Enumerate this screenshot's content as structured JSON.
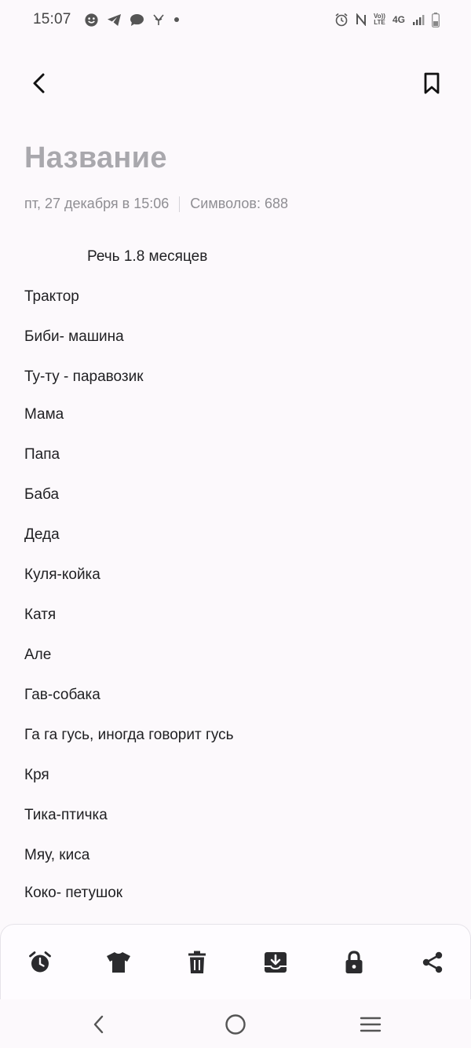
{
  "status_bar": {
    "time": "15:07",
    "left_icons": [
      "smiley-icon",
      "telegram-icon",
      "chat-bubble-icon",
      "vpn-icon",
      "dot-icon"
    ],
    "right_icons": [
      "alarm-icon",
      "nfc-icon",
      "volte-icon",
      "network-4g-icon",
      "signal-icon",
      "battery-icon"
    ],
    "volte_top": "Vo))",
    "volte_bottom": "LTE",
    "network": "4G"
  },
  "top_bar": {
    "back_icon": "chevron-left-icon",
    "bookmark_icon": "bookmark-icon"
  },
  "note": {
    "title": "Название",
    "date": "пт, 27 декабря в 15:06",
    "char_count": "Символов: 688",
    "lines": [
      {
        "text": "Речь 1.8 месяцев",
        "indent": true
      },
      {
        "text": "Трактор"
      },
      {
        "text": "Биби- машина"
      },
      {
        "text": "Ту-ту - паравозик"
      },
      {
        "text": "Мама"
      },
      {
        "text": "Папа"
      },
      {
        "text": "Баба"
      },
      {
        "text": "Деда"
      },
      {
        "text": "Куля-койка"
      },
      {
        "text": "Катя"
      },
      {
        "text": "Але"
      },
      {
        "text": "Гав-собака"
      },
      {
        "text": "Га га гусь, иногда говорит гусь"
      },
      {
        "text": "Кря"
      },
      {
        "text": "Тика-птичка"
      },
      {
        "text": "Мяу, киса"
      },
      {
        "text": "Коко- петушок"
      }
    ]
  },
  "toolbar": {
    "items": [
      "alarm-clock-icon",
      "t-shirt-icon",
      "trash-icon",
      "download-tray-icon",
      "lock-icon",
      "share-icon"
    ]
  },
  "nav_bar": {
    "items": [
      "back-nav-icon",
      "home-nav-icon",
      "recents-nav-icon"
    ]
  },
  "colors": {
    "background": "#fcf9fc",
    "title_placeholder": "#a9a8ad",
    "meta": "#8f8e93",
    "icon": "#2b2b2e"
  }
}
